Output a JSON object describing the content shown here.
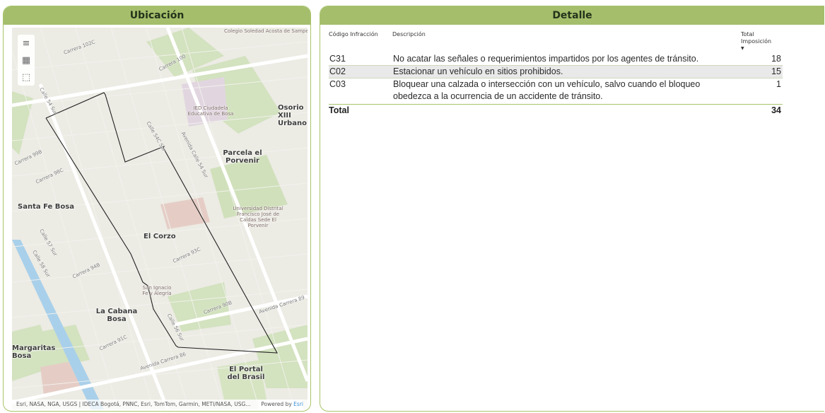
{
  "map_panel": {
    "title": "Ubicación",
    "toolbar_icons": [
      "menu-icon",
      "legend-grid-icon",
      "select-region-icon"
    ],
    "labels": {
      "colegio": "Colegio Soledad Acosta de Samper",
      "ied": "IED Ciudadela Educativa de Bosa",
      "osorio": "Osorio XIII Urbano",
      "parcela": "Parcela el Porvenir",
      "santa_fe": "Santa Fe Bosa",
      "universidad": "Universidad Distrital Francisco José de Caldas Sede El Porvenir",
      "corzo": "El Corzo",
      "san_ignacio": "San Ignacio Fe y Alegría",
      "cabana": "La Cabana Bosa",
      "margaritas": "Margaritas Bosa",
      "portal": "El Portal del Brasil",
      "carrera_102c": "Carrera 102C",
      "carrera_100": "Carrera 100",
      "carrera_99b": "Carrera 99B",
      "carrera_98c": "Carrera 98C",
      "carrera_94b": "Carrera 94B",
      "carrera_93c": "Carrera 93C",
      "carrera_91c": "Carrera 91C",
      "carrera_90b": "Carrera 90B",
      "calle_54_sur": "Calle 54 Sur",
      "calle_54c_sur": "Calle 54C Sur",
      "calle_57_sur": "Calle 57 Sur",
      "calle_58_sur": "Calle 58 Sur",
      "calle_56_sur": "Calle 56 Sur",
      "avenida_calle_54": "Avenida Calle 54 Sur",
      "avenida_carrera_89": "Avenida Carrera 89",
      "avenida_carrera_86": "Avenida Carrera 86"
    },
    "attribution": "Esri, NASA, NGA, USGS | IDECA Bogotá, PNNC, Esri, TomTom, Garmin, METI/NASA, USG...",
    "powered_by": "Powered by",
    "powered_by_brand": "Esri"
  },
  "detail_panel": {
    "title": "Detalle",
    "columns": {
      "code": "Código Infracción",
      "description": "Descripción",
      "total": "Total Imposición"
    },
    "rows": [
      {
        "code": "C31",
        "description": "No acatar las señales o requerimientos impartidos por los agentes de tránsito.",
        "total": "18"
      },
      {
        "code": "C02",
        "description": "Estacionar un vehículo en sitios prohibidos.",
        "total": "15"
      },
      {
        "code": "C03",
        "description": "Bloquear una calzada o intersección con un vehículo, salvo cuando el bloqueo obedezca a la ocurrencia de un accidente de tránsito.",
        "total": "1"
      }
    ],
    "total_label": "Total",
    "total_value": "34"
  },
  "colors": {
    "header_bg": "#a4be6c",
    "border": "#a8c46a",
    "park": "#c9dcb1",
    "water": "#a9d0ea",
    "road": "#ffffff"
  }
}
